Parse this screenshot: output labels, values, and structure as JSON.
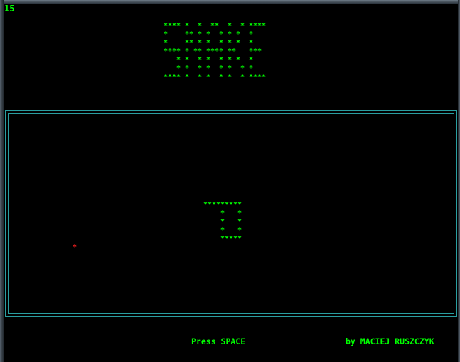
{
  "colors": {
    "background": "#000000",
    "text": "#00ff00",
    "food": "#ff2020",
    "border": "#2a9ea0"
  },
  "hud": {
    "score": "15"
  },
  "logo": {
    "art": "**** *  *  **  *  * ****\n*    ** * *  * * *  *\n*    ** * *  * * *  *\n**** * ** **** **   ***\n   * *  * *  * * *  *\n   * *  * *  * *  * *\n**** *  * *  * *  * ****"
  },
  "playfield": {
    "snake_art": "*********\n    *   *\n    *   *\n    *   *\n    *****",
    "food_char": "*"
  },
  "footer": {
    "prompt": "Press SPACE",
    "credits": "by MACIEJ RUSZCZYK"
  }
}
